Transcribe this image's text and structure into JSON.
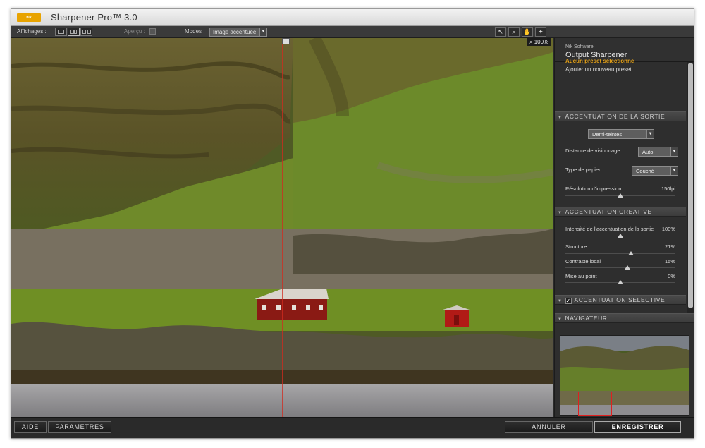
{
  "window": {
    "logo_text": "nik Software",
    "title": "Sharpener Pro™ 3.0"
  },
  "toolbar": {
    "affichages_label": "Affichages :",
    "apercu_label": "Aperçu :",
    "modes_label": "Modes :",
    "mode_value": "Image accentuée"
  },
  "canvas": {
    "zoom_label": "100%"
  },
  "panel": {
    "vendor": "Nik Software",
    "product": "Output Sharpener",
    "preset_title": "Aucun preset sélectionné",
    "preset_add": "Ajouter un nouveau preset",
    "section_output": {
      "title": "ACCENTUATION DE LA SORTIE",
      "mode_dropdown": "Demi-teintes",
      "viewing_distance_label": "Distance de visionnage",
      "viewing_distance_value": "Auto",
      "paper_type_label": "Type de papier",
      "paper_type_value": "Couché",
      "print_resolution_label": "Résolution d'impression",
      "print_resolution_value": "150lpi",
      "print_resolution_level": 0.5
    },
    "section_creative": {
      "title": "ACCENTUATION CREATIVE",
      "sliders": [
        {
          "label": "Intensité de l'accentuation de la sortie",
          "value": "100%",
          "level": 0.5
        },
        {
          "label": "Structure",
          "value": "21%",
          "level": 0.6
        },
        {
          "label": "Contraste local",
          "value": "15%",
          "level": 0.57
        },
        {
          "label": "Mise au point",
          "value": "0%",
          "level": 0.5
        }
      ]
    },
    "section_selective": {
      "title": "ACCENTUATION SELECTIVE",
      "checked": true
    },
    "section_navigator": {
      "title": "NAVIGATEUR"
    }
  },
  "footer": {
    "help_label": "AIDE",
    "settings_label": "PARAMETRES",
    "cancel_label": "ANNULER",
    "save_label": "ENREGISTRER"
  },
  "colors": {
    "accent_orange": "#e8a317",
    "split_line": "#d22b1f",
    "navigator_rect": "#e02020"
  }
}
